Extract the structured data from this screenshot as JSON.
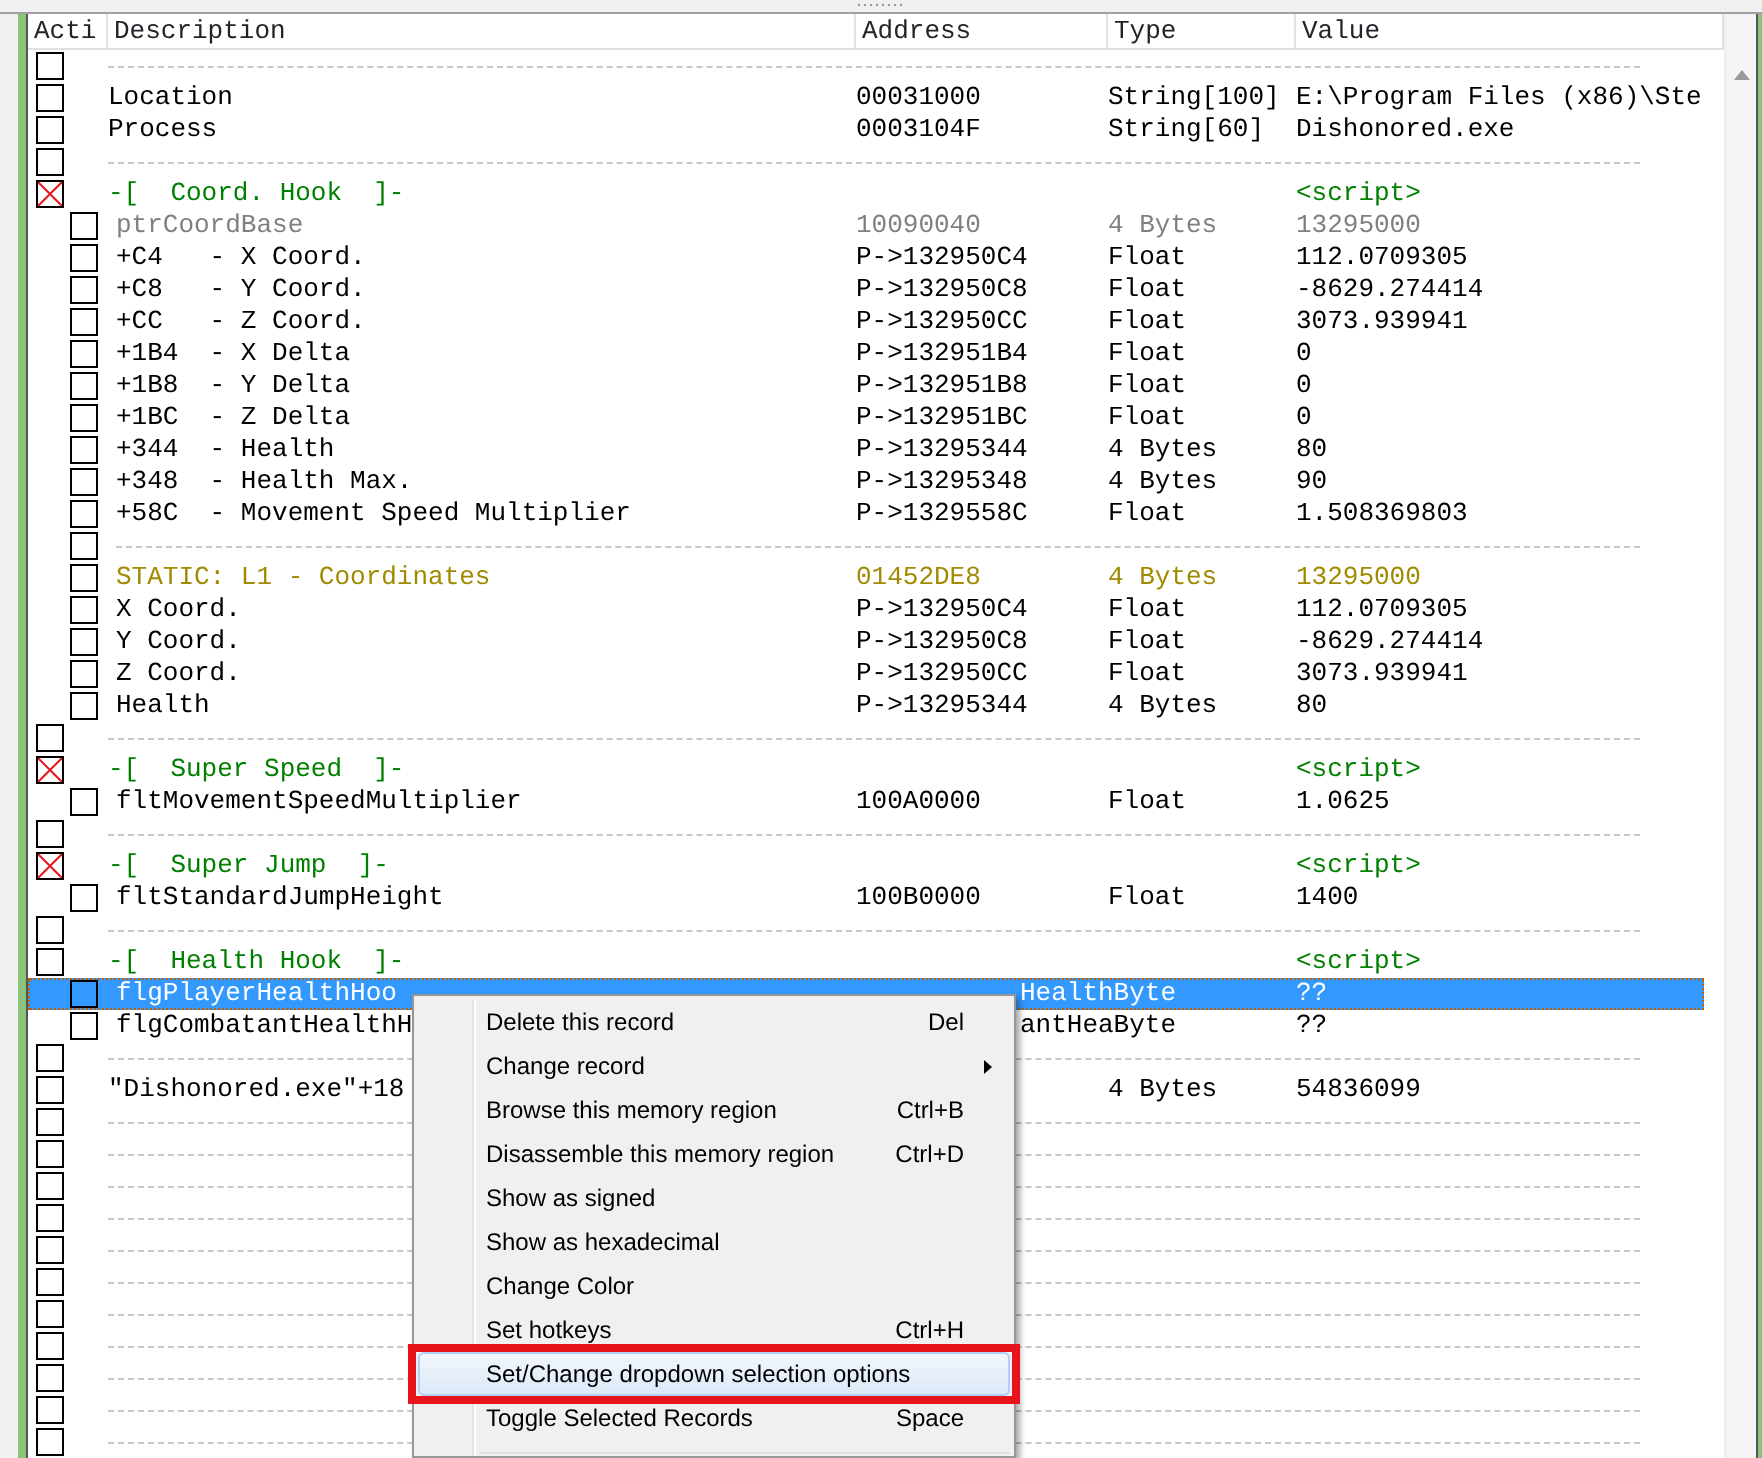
{
  "columns": [
    {
      "label": "Acti"
    },
    {
      "label": "Description"
    },
    {
      "label": "Address"
    },
    {
      "label": "Type"
    },
    {
      "label": "Value"
    }
  ],
  "rows": [
    {
      "kind": "separator",
      "checked": false,
      "selected": false
    },
    {
      "kind": "record",
      "checked": false,
      "selected": false,
      "description": "Location",
      "address": "00031000",
      "type": "String[100]",
      "value": "E:\\Program Files (x86)\\Ste"
    },
    {
      "kind": "record",
      "checked": false,
      "selected": false,
      "description": "Process",
      "address": "0003104F",
      "type": "String[60]",
      "value": "Dishonored.exe"
    },
    {
      "kind": "separator",
      "checked": false,
      "selected": false
    },
    {
      "kind": "group",
      "checked": true,
      "selected": false,
      "color": "#008000",
      "description": "-[  Coord. Hook  ]-",
      "value": "<script>",
      "children": [
        {
          "kind": "record",
          "checked": false,
          "selected": false,
          "color": "#808080",
          "description": "ptrCoordBase",
          "address": "10090040",
          "type": "4 Bytes",
          "value": "13295000"
        },
        {
          "kind": "record",
          "checked": false,
          "selected": false,
          "description": "+C4   - X Coord.",
          "address": "P->132950C4",
          "type": "Float",
          "value": "112.0709305"
        },
        {
          "kind": "record",
          "checked": false,
          "selected": false,
          "description": "+C8   - Y Coord.",
          "address": "P->132950C8",
          "type": "Float",
          "value": "-8629.274414"
        },
        {
          "kind": "record",
          "checked": false,
          "selected": false,
          "description": "+CC   - Z Coord.",
          "address": "P->132950CC",
          "type": "Float",
          "value": "3073.939941"
        },
        {
          "kind": "record",
          "checked": false,
          "selected": false,
          "description": "+1B4  - X Delta",
          "address": "P->132951B4",
          "type": "Float",
          "value": "0"
        },
        {
          "kind": "record",
          "checked": false,
          "selected": false,
          "description": "+1B8  - Y Delta",
          "address": "P->132951B8",
          "type": "Float",
          "value": "0"
        },
        {
          "kind": "record",
          "checked": false,
          "selected": false,
          "description": "+1BC  - Z Delta",
          "address": "P->132951BC",
          "type": "Float",
          "value": "0"
        },
        {
          "kind": "record",
          "checked": false,
          "selected": false,
          "description": "+344  - Health",
          "address": "P->13295344",
          "type": "4 Bytes",
          "value": "80"
        },
        {
          "kind": "record",
          "checked": false,
          "selected": false,
          "description": "+348  - Health Max.",
          "address": "P->13295348",
          "type": "4 Bytes",
          "value": "90"
        },
        {
          "kind": "record",
          "checked": false,
          "selected": false,
          "description": "+58C  - Movement Speed Multiplier",
          "address": "P->1329558C",
          "type": "Float",
          "value": "1.508369803"
        },
        {
          "kind": "separator",
          "checked": false,
          "selected": false
        },
        {
          "kind": "record",
          "checked": false,
          "selected": false,
          "color": "#a08a00",
          "description": "STATIC: L1 - Coordinates",
          "address": "01452DE8",
          "type": "4 Bytes",
          "value": "13295000"
        },
        {
          "kind": "record",
          "checked": false,
          "selected": false,
          "description": "X Coord.",
          "address": "P->132950C4",
          "type": "Float",
          "value": "112.0709305"
        },
        {
          "kind": "record",
          "checked": false,
          "selected": false,
          "description": "Y Coord.",
          "address": "P->132950C8",
          "type": "Float",
          "value": "-8629.274414"
        },
        {
          "kind": "record",
          "checked": false,
          "selected": false,
          "description": "Z Coord.",
          "address": "P->132950CC",
          "type": "Float",
          "value": "3073.939941"
        },
        {
          "kind": "record",
          "checked": false,
          "selected": false,
          "description": "Health",
          "address": "P->13295344",
          "type": "4 Bytes",
          "value": "80"
        }
      ]
    },
    {
      "kind": "separator",
      "checked": false,
      "selected": false
    },
    {
      "kind": "group",
      "checked": true,
      "selected": false,
      "color": "#008000",
      "description": "-[  Super Speed  ]-",
      "value": "<script>",
      "children": [
        {
          "kind": "record",
          "checked": false,
          "selected": false,
          "description": "fltMovementSpeedMultiplier",
          "address": "100A0000",
          "type": "Float",
          "value": "1.0625"
        }
      ]
    },
    {
      "kind": "separator",
      "checked": false,
      "selected": false
    },
    {
      "kind": "group",
      "checked": true,
      "selected": false,
      "color": "#008000",
      "description": "-[  Super Jump  ]-",
      "value": "<script>",
      "children": [
        {
          "kind": "record",
          "checked": false,
          "selected": false,
          "description": "fltStandardJumpHeight",
          "address": "100B0000",
          "type": "Float",
          "value": "1400"
        }
      ]
    },
    {
      "kind": "separator",
      "checked": false,
      "selected": false
    },
    {
      "kind": "group",
      "checked": false,
      "selected": false,
      "color": "#008000",
      "description": "-[  Health Hook  ]-",
      "value": "<script>",
      "children": [
        {
          "kind": "record",
          "checked": false,
          "selected": true,
          "description": "flgPlayerHealthHoo",
          "address": "HealthByte",
          "address_covered": true,
          "value": "??"
        },
        {
          "kind": "record",
          "checked": false,
          "selected": false,
          "description": "flgCombatantHealthH",
          "address": "antHeaByte",
          "address_covered": true,
          "value": "??"
        }
      ]
    },
    {
      "kind": "separator",
      "checked": false,
      "selected": false
    },
    {
      "kind": "record",
      "checked": false,
      "selected": false,
      "description": "\"Dishonored.exe\"+18",
      "type": "4 Bytes",
      "value": "54836099"
    },
    {
      "kind": "separator",
      "checked": false,
      "selected": false
    },
    {
      "kind": "separator",
      "checked": false,
      "selected": false
    },
    {
      "kind": "separator",
      "checked": false,
      "selected": false
    },
    {
      "kind": "separator",
      "checked": false,
      "selected": false
    },
    {
      "kind": "separator",
      "checked": false,
      "selected": false
    },
    {
      "kind": "separator",
      "checked": false,
      "selected": false
    },
    {
      "kind": "separator",
      "checked": false,
      "selected": false
    },
    {
      "kind": "separator",
      "checked": false,
      "selected": false
    },
    {
      "kind": "separator",
      "checked": false,
      "selected": false
    },
    {
      "kind": "separator",
      "checked": false,
      "selected": false
    },
    {
      "kind": "separator",
      "checked": false,
      "selected": false
    }
  ],
  "context_menu": {
    "items": [
      {
        "label": "Delete this record",
        "shortcut": "Del",
        "submenu": false,
        "selected": false
      },
      {
        "label": "Change record",
        "submenu": true,
        "selected": false
      },
      {
        "label": "Browse this memory region",
        "shortcut": "Ctrl+B",
        "submenu": false,
        "selected": false
      },
      {
        "label": "Disassemble this memory region",
        "shortcut": "Ctrl+D",
        "submenu": false,
        "selected": false
      },
      {
        "label": "Show as signed",
        "submenu": false,
        "selected": false
      },
      {
        "label": "Show as hexadecimal",
        "submenu": false,
        "selected": false
      },
      {
        "label": "Change Color",
        "submenu": false,
        "selected": false
      },
      {
        "label": "Set hotkeys",
        "shortcut": "Ctrl+H",
        "submenu": false,
        "selected": false
      },
      {
        "label": "Set/Change dropdown selection options",
        "submenu": false,
        "selected": true,
        "annotated": true
      },
      {
        "label": "Toggle Selected Records",
        "shortcut": "Space",
        "submenu": false,
        "selected": false
      }
    ]
  }
}
